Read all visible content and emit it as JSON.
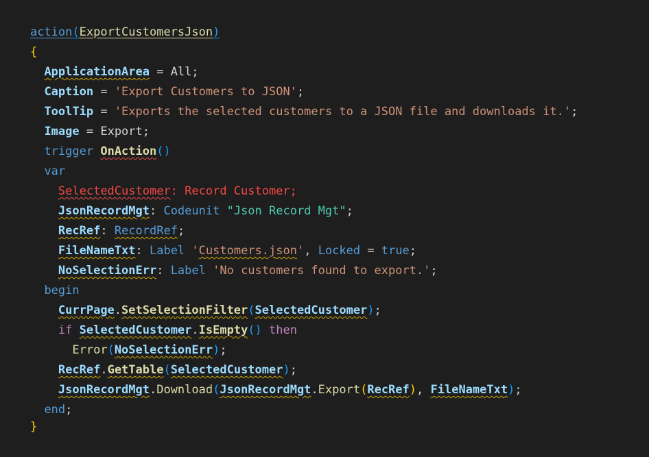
{
  "editor": {
    "line01": {
      "action_kw": "action",
      "open_paren": "(",
      "action_name": "ExportCustomersJson",
      "close_paren": ")"
    },
    "line02": {
      "brace": "{"
    },
    "line03": {
      "prop": "ApplicationArea",
      "op": " = ",
      "value": "All",
      "semi": ";"
    },
    "line04": {
      "prop": "Caption",
      "op": " = ",
      "value": "'Export Customers to JSON'",
      "semi": ";"
    },
    "line05": {
      "prop": "ToolTip",
      "op": " = ",
      "value": "'Exports the selected customers to a JSON file and downloads it.'",
      "semi": ";"
    },
    "line06": {
      "prop": "Image",
      "op": " = ",
      "value": "Export",
      "semi": ";"
    },
    "line07": {
      "trigger_kw": "trigger",
      "space": " ",
      "name": "OnAction",
      "parens": "()"
    },
    "line08": {
      "var_kw": "var"
    },
    "line09": {
      "name": "SelectedCustomer",
      "rest": ": Record Customer;"
    },
    "line10": {
      "name": "JsonRecordMgt",
      "colon": ": ",
      "type_kw": "Codeunit",
      "space": " ",
      "type_name": "\"Json Record Mgt\"",
      "semi": ";"
    },
    "line11": {
      "name": "RecRef",
      "colon": ": ",
      "type_kw": "RecordRef",
      "semi": ";"
    },
    "line12": {
      "name": "FileNameTxt",
      "colon": ": ",
      "type_kw": "Label",
      "space": " ",
      "str_open": "'",
      "str_body": "Customers.json",
      "str_close": "'",
      "comma": ", ",
      "locked_kw": "Locked",
      "eq": " = ",
      "true_kw": "true",
      "semi": ";"
    },
    "line13": {
      "name": "NoSelectionErr",
      "colon": ": ",
      "type_kw": "Label",
      "space": " ",
      "str": "'No customers found to export.'",
      "semi": ";"
    },
    "line14": {
      "begin_kw": "begin"
    },
    "line15": {
      "obj": "CurrPage",
      "dot": ".",
      "method": "SetSelectionFilter",
      "open": "(",
      "arg": "SelectedCustomer",
      "close": ")",
      "semi": ";"
    },
    "line16": {
      "if_kw": "if",
      "space": " ",
      "obj": "SelectedCustomer",
      "dot": ".",
      "method": "IsEmpty",
      "parens": "()",
      "space2": " ",
      "then_kw": "then"
    },
    "line17": {
      "fn": "Error",
      "open": "(",
      "arg": "NoSelectionErr",
      "close": ")",
      "semi": ";"
    },
    "line18": {
      "obj": "RecRef",
      "dot": ".",
      "method": "GetTable",
      "open": "(",
      "arg": "SelectedCustomer",
      "close": ")",
      "semi": ";"
    },
    "line19": {
      "obj": "JsonRecordMgt",
      "dot": ".",
      "method": "Download",
      "open": "(",
      "obj2": "JsonRecordMgt",
      "dot2": ".",
      "method2": "Export",
      "open2": "(",
      "arg": "RecRef",
      "close2": ")",
      "comma": ", ",
      "arg2": "FileNameTxt",
      "close": ")",
      "semi": ";"
    },
    "line20": {
      "end_kw": "end",
      "semi": ";"
    },
    "line21": {
      "brace": "}"
    }
  }
}
